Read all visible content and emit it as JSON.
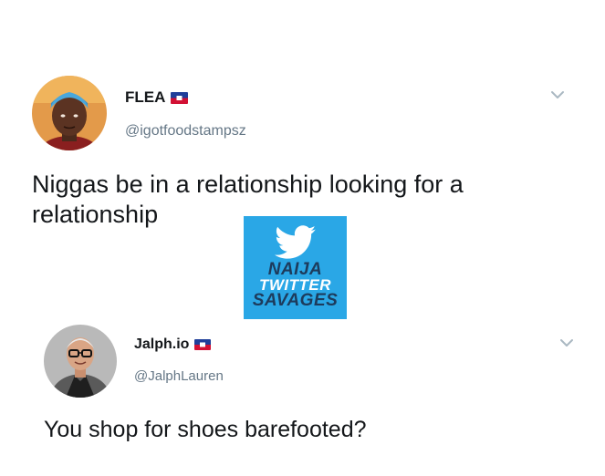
{
  "tweets": [
    {
      "display_name": "FLEA",
      "handle": "@igotfoodstampsz",
      "text_line1": "Niggas be in a relationship looking for a",
      "text_line2": "relationship",
      "flag_icon": "haiti-flag-icon",
      "menu_icon": "chevron-down-icon"
    },
    {
      "display_name": "Jalph.io",
      "handle": "@JalphLauren",
      "text_line1": "You shop for shoes barefooted?",
      "flag_icon": "haiti-flag-icon",
      "menu_icon": "chevron-down-icon"
    }
  ],
  "watermark": {
    "line1": "NAIJA",
    "line2": "TWITTER",
    "line3": "SAVAGES",
    "icon": "twitter-bird-icon",
    "background_color": "#2aa7e6"
  },
  "colors": {
    "text": "#14171a",
    "handle": "#657786",
    "chevron": "#aab8c2",
    "flag_blue": "#1f3f9a",
    "flag_red": "#d21034"
  }
}
